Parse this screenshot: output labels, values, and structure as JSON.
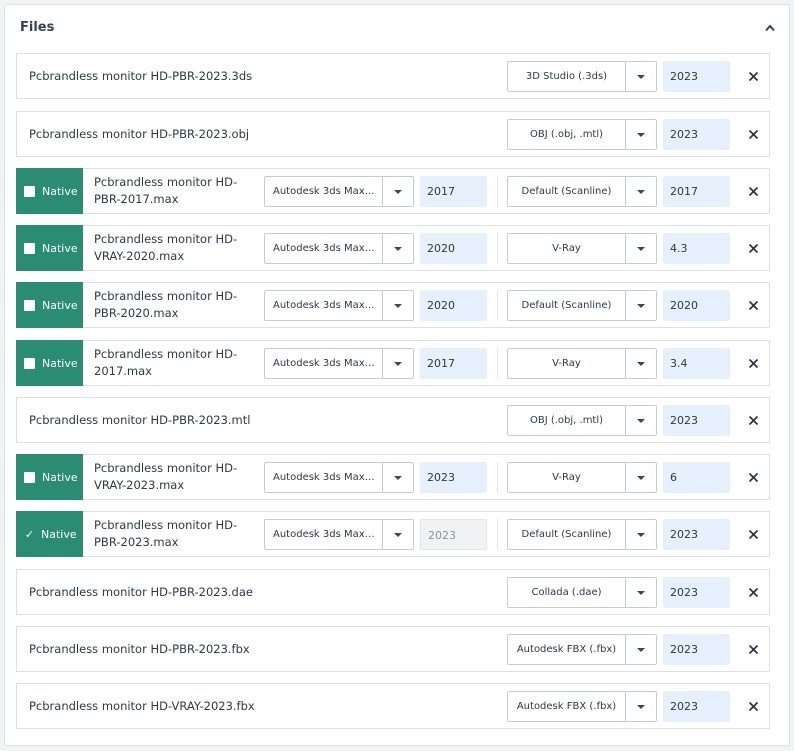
{
  "panel": {
    "title": "Files"
  },
  "files": [
    {
      "name": "Pcbrandless monitor HD-PBR-2023.3ds",
      "format": "3D Studio (.3ds)",
      "format_version": "2023"
    },
    {
      "name": "Pcbrandless monitor HD-PBR-2023.obj",
      "format": "OBJ (.obj, .mtl)",
      "format_version": "2023"
    },
    {
      "native": false,
      "native_label": "Native",
      "name": "Pcbrandless monitor HD-PBR-2017.max",
      "app": "Autodesk 3ds Max (...",
      "app_version": "2017",
      "renderer": "Default (Scanline)",
      "renderer_version": "2017"
    },
    {
      "native": false,
      "native_label": "Native",
      "name": "Pcbrandless monitor HD-VRAY-2020.max",
      "app": "Autodesk 3ds Max (...",
      "app_version": "2020",
      "renderer": "V-Ray",
      "renderer_version": "4.3"
    },
    {
      "native": false,
      "native_label": "Native",
      "name": "Pcbrandless monitor HD-PBR-2020.max",
      "app": "Autodesk 3ds Max (...",
      "app_version": "2020",
      "renderer": "Default (Scanline)",
      "renderer_version": "2020"
    },
    {
      "native": false,
      "native_label": "Native",
      "name": "Pcbrandless monitor HD-2017.max",
      "app": "Autodesk 3ds Max (...",
      "app_version": "2017",
      "renderer": "V-Ray",
      "renderer_version": "3.4"
    },
    {
      "name": "Pcbrandless monitor HD-PBR-2023.mtl",
      "format": "OBJ (.obj, .mtl)",
      "format_version": "2023"
    },
    {
      "native": false,
      "native_label": "Native",
      "name": "Pcbrandless monitor HD-VRAY-2023.max",
      "app": "Autodesk 3ds Max (...",
      "app_version": "2023",
      "renderer": "V-Ray",
      "renderer_version": "6"
    },
    {
      "native": true,
      "native_label": "Native",
      "name": "Pcbrandless monitor HD-PBR-2023.max",
      "app": "Autodesk 3ds Max (...",
      "app_version": "2023",
      "app_version_disabled": true,
      "renderer": "Default (Scanline)",
      "renderer_version": "2023"
    },
    {
      "name": "Pcbrandless monitor HD-PBR-2023.dae",
      "format": "Collada (.dae)",
      "format_version": "2023"
    },
    {
      "name": "Pcbrandless monitor HD-PBR-2023.fbx",
      "format": "Autodesk FBX (.fbx)",
      "format_version": "2023"
    },
    {
      "name": "Pcbrandless monitor HD-VRAY-2023.fbx",
      "format": "Autodesk FBX (.fbx)",
      "format_version": "2023"
    }
  ],
  "colors": {
    "native_bg": "#2a8c72",
    "version_bg": "#e6f0fc",
    "border": "#dcdfe3"
  },
  "icons": {
    "collapse": "chevron-up-icon",
    "remove": "close-icon",
    "dropdown": "caret-down-icon",
    "checkbox": "checkbox-icon"
  }
}
